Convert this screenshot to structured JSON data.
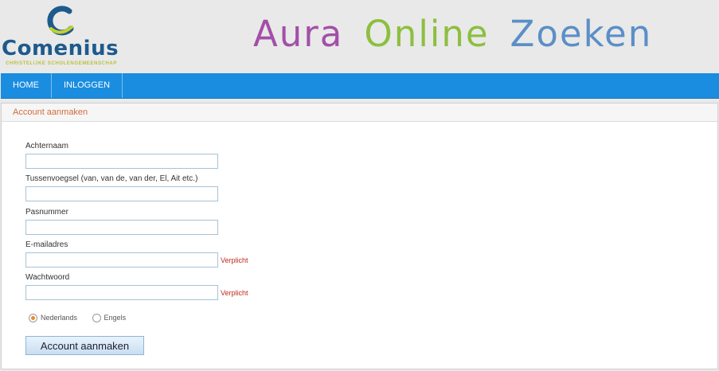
{
  "header": {
    "logo_text": "Comenius",
    "logo_subtitle": "CHRISTELIJKE SCHOLENGEMEENSCHAP",
    "banner": [
      {
        "text": "Aura",
        "color": "#a34fa8"
      },
      {
        "text": "Online",
        "color": "#8cbf3f"
      },
      {
        "text": "Zoeken",
        "color": "#5b8fc7"
      }
    ]
  },
  "nav": {
    "items": [
      {
        "label": "HOME"
      },
      {
        "label": "INLOGGEN"
      }
    ]
  },
  "panel": {
    "title": "Account aanmaken",
    "fields": [
      {
        "label": "Achternaam",
        "value": "",
        "required": ""
      },
      {
        "label": "Tussenvoegsel (van, van de, van der, El, Ait etc.)",
        "value": "",
        "required": ""
      },
      {
        "label": "Pasnummer",
        "value": "",
        "required": ""
      },
      {
        "label": "E-mailadres",
        "value": "",
        "required": "Verplicht"
      },
      {
        "label": "Wachtwoord",
        "value": "",
        "required": "Verplicht"
      }
    ],
    "language": {
      "options": [
        {
          "label": "Nederlands",
          "selected": true
        },
        {
          "label": "Engels",
          "selected": false
        }
      ]
    },
    "submit_label": "Account aanmaken"
  },
  "colors": {
    "nav_bg": "#1a8de0",
    "title_accent": "#d26b3c",
    "required": "#c02a1a"
  }
}
